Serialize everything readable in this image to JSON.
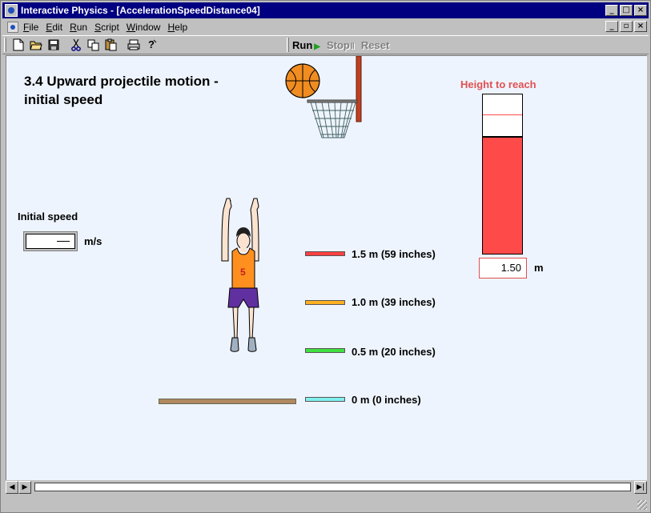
{
  "window": {
    "title": "Interactive Physics - [AccelerationSpeedDistance04]",
    "buttons": [
      "_",
      "□",
      "×"
    ],
    "mdi_buttons": [
      "_",
      "▫",
      "×"
    ]
  },
  "menu": {
    "items": [
      {
        "ul": "F",
        "rest": "ile"
      },
      {
        "ul": "E",
        "rest": "dit"
      },
      {
        "ul": "R",
        "rest": "un"
      },
      {
        "ul": "S",
        "rest": "cript"
      },
      {
        "ul": "W",
        "rest": "indow"
      },
      {
        "ul": "H",
        "rest": "elp"
      }
    ]
  },
  "toolbar": {
    "icons": [
      "new-icon",
      "open-icon",
      "save-icon",
      "cut-icon",
      "copy-icon",
      "paste-icon",
      "print-icon",
      "help-icon"
    ],
    "run_label": "Run",
    "stop_label": "Stop",
    "reset_label": "Reset"
  },
  "scene": {
    "title": "3.4 Upward projectile motion - initial speed",
    "speed_label": "Initial speed",
    "speed_value": "",
    "speed_unit": "m/s",
    "height_label": "Height to reach",
    "height_value": "1.50",
    "height_unit": "m",
    "height_gauge_fill_fraction": 0.74,
    "height_gauge_target_fraction": 0.87,
    "jersey_number": "5",
    "legend": [
      {
        "label": "1.5 m (59 inches)",
        "color": "#ff4040"
      },
      {
        "label": "1.0 m (39 inches)",
        "color": "#ffb020"
      },
      {
        "label": "0.5 m (20 inches)",
        "color": "#40e040"
      },
      {
        "label": "0 m (0 inches)",
        "color": "#80f0f0"
      }
    ]
  }
}
